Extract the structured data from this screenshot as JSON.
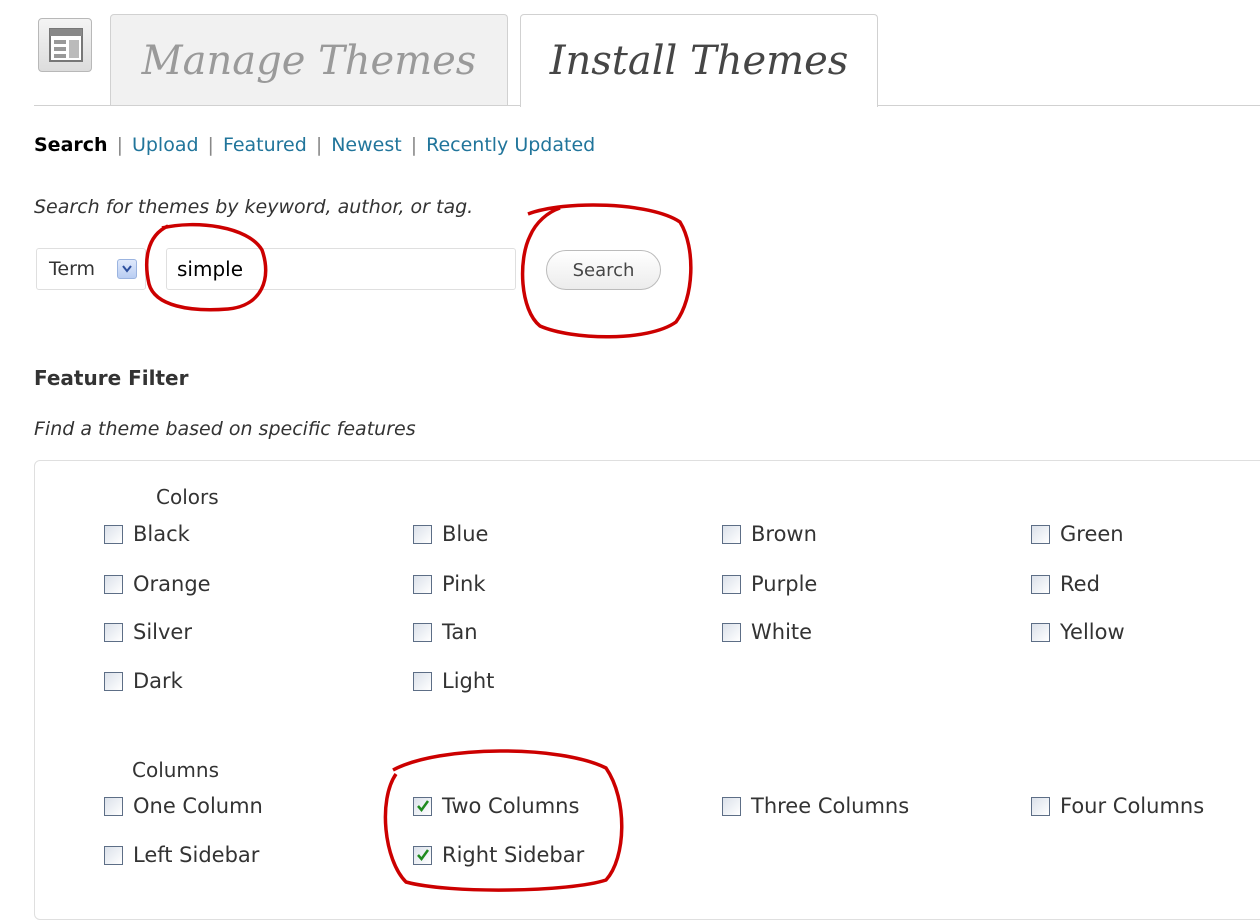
{
  "tabs": [
    {
      "label": "Manage Themes",
      "active": false
    },
    {
      "label": "Install Themes",
      "active": true
    }
  ],
  "subnav": {
    "current": "Search",
    "links": [
      "Upload",
      "Featured",
      "Newest",
      "Recently Updated"
    ],
    "separator": "|"
  },
  "search": {
    "description": "Search for themes by keyword, author, or tag.",
    "type_select": "Term",
    "query": "simple",
    "button_label": "Search"
  },
  "feature_filter": {
    "heading": "Feature Filter",
    "description": "Find a theme based on specific features",
    "groups": [
      {
        "label": "Colors",
        "options": [
          {
            "label": "Black",
            "checked": false
          },
          {
            "label": "Blue",
            "checked": false
          },
          {
            "label": "Brown",
            "checked": false
          },
          {
            "label": "Green",
            "checked": false
          },
          {
            "label": "Orange",
            "checked": false
          },
          {
            "label": "Pink",
            "checked": false
          },
          {
            "label": "Purple",
            "checked": false
          },
          {
            "label": "Red",
            "checked": false
          },
          {
            "label": "Silver",
            "checked": false
          },
          {
            "label": "Tan",
            "checked": false
          },
          {
            "label": "White",
            "checked": false
          },
          {
            "label": "Yellow",
            "checked": false
          },
          {
            "label": "Dark",
            "checked": false
          },
          {
            "label": "Light",
            "checked": false
          }
        ]
      },
      {
        "label": "Columns",
        "options": [
          {
            "label": "One Column",
            "checked": false
          },
          {
            "label": "Two Columns",
            "checked": true
          },
          {
            "label": "Three Columns",
            "checked": false
          },
          {
            "label": "Four Columns",
            "checked": false
          },
          {
            "label": "Left Sidebar",
            "checked": false
          },
          {
            "label": "Right Sidebar",
            "checked": true
          }
        ]
      }
    ]
  },
  "colors": {
    "link": "#21759b",
    "annotation": "#cc0000",
    "check": "#1e8a1e"
  }
}
